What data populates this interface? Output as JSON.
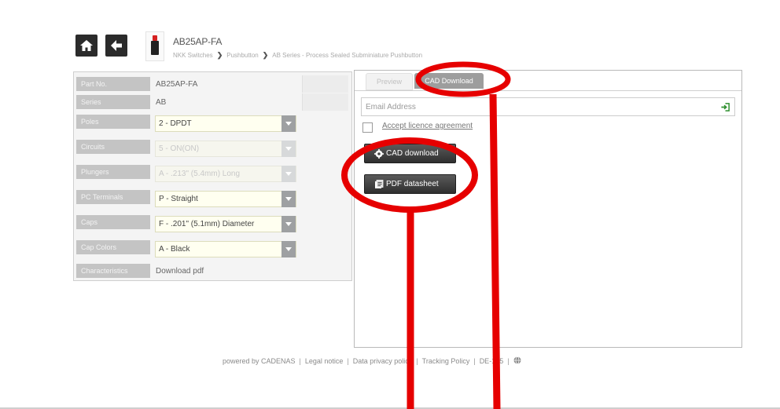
{
  "header": {
    "part_number": "AB25AP-FA",
    "breadcrumb": [
      "NKK Switches",
      "Pushbutton",
      "AB Series - Process Sealed Subminiature Pushbutton"
    ]
  },
  "attributes": [
    {
      "label": "Part No.",
      "type": "text",
      "value": "AB25AP-FA"
    },
    {
      "label": "Series",
      "type": "text",
      "value": "AB"
    },
    {
      "label": "Poles",
      "type": "select",
      "value": "2 - DPDT",
      "disabled": false
    },
    {
      "label": "Circuits",
      "type": "select",
      "value": "5 - ON(ON)",
      "disabled": true
    },
    {
      "label": "Plungers",
      "type": "select",
      "value": "A - .213\" (5.4mm) Long",
      "disabled": true
    },
    {
      "label": "PC Terminals",
      "type": "select",
      "value": "P - Straight",
      "disabled": false
    },
    {
      "label": "Caps",
      "type": "select",
      "value": "F - .201\" (5.1mm) Diameter",
      "disabled": false
    },
    {
      "label": "Cap Colors",
      "type": "select",
      "value": "A - Black",
      "disabled": false
    },
    {
      "label": "Characteristics",
      "type": "text",
      "value": "Download pdf"
    }
  ],
  "tabs": {
    "preview": "Preview",
    "cad_download": "CAD Download",
    "active": "cad_download"
  },
  "download_form": {
    "email_placeholder": "Email Address",
    "email_value": "",
    "licence_label": "Accept licence agreement",
    "licence_checked": false,
    "cad_button": "CAD download",
    "pdf_button": "PDF datasheet"
  },
  "footer": {
    "powered_by": "powered by CADENAS",
    "legal": "Legal notice",
    "privacy": "Data privacy policy",
    "tracking": "Tracking Policy",
    "locale": "DE-125"
  },
  "colors": {
    "annotation": "#e60000",
    "button_dark": "#2f2f2f",
    "tab_active": "#9d9d9d",
    "select_bg": "#fffff0",
    "label_bg": "#c4c4c4"
  },
  "icons": [
    "home-icon",
    "back-arrow-icon",
    "signin-icon",
    "cad-download-icon",
    "pdf-datasheet-icon",
    "globe-icon"
  ]
}
